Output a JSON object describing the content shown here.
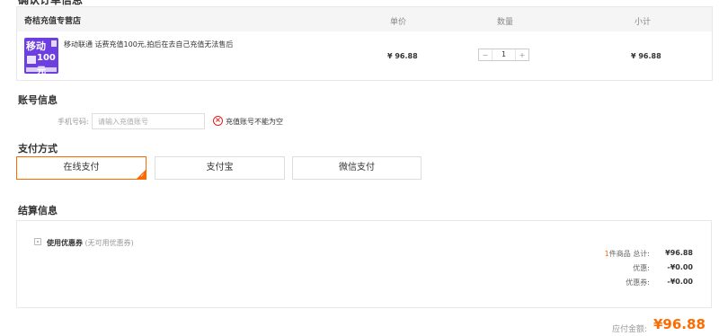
{
  "cut_title": "确认订单信息",
  "order": {
    "shop": "奇桔充值专营店",
    "headers": {
      "price": "单价",
      "qty": "数量",
      "subtotal": "小计"
    },
    "item": {
      "thumb_top": "移动",
      "thumb_amount": "100元",
      "name": "移动联通 话费充值100元,拍后在去自己充值无法售后",
      "price": "¥ 96.88",
      "qty": "1",
      "minus": "−",
      "plus": "+",
      "subtotal": "¥ 96.88"
    }
  },
  "account": {
    "title": "账号信息",
    "label": "手机号码:",
    "placeholder": "请输入充值账号",
    "error_icon": "close-circle-icon",
    "error": "充值账号不能为空"
  },
  "payment": {
    "title": "支付方式",
    "options": [
      {
        "label": "在线支付",
        "selected": true
      },
      {
        "label": "支付宝",
        "selected": false
      },
      {
        "label": "微信支付",
        "selected": false
      }
    ],
    "accent": "#ff6a00"
  },
  "settle": {
    "title": "结算信息",
    "coupon_label": "使用优惠券",
    "coupon_note": " (无可用优惠券)",
    "count_num": "1",
    "count_text": "件商品  总计:",
    "total": "¥96.88",
    "discount_label": "优惠:",
    "discount": "-¥0.00",
    "coupon_row_label": "优惠券:",
    "coupon_value": "-¥0.00"
  },
  "payable": {
    "label": "应付金额:",
    "value": "¥96.88"
  }
}
